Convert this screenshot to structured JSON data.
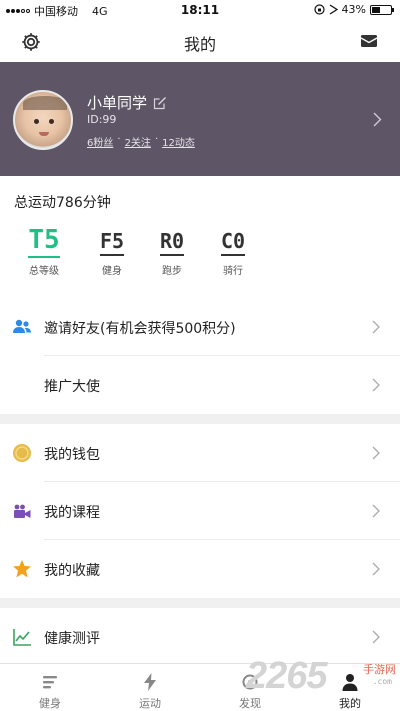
{
  "status_bar": {
    "carrier": "中国移动",
    "network": "4G",
    "time": "18:11",
    "battery": "43%",
    "battery_level": 0.43
  },
  "nav": {
    "title": "我的",
    "left_icon": "gear-icon",
    "right_icon": "mail-icon"
  },
  "profile": {
    "name": "小单同学",
    "id": "ID:99",
    "fans": "6粉丝",
    "following": "2关注",
    "posts": "12动态",
    "dot": "·",
    "bg_color": "#5e5566"
  },
  "total": {
    "label": "总运动786分钟"
  },
  "levels": [
    {
      "code": "T5",
      "label": "总等级"
    },
    {
      "code": "F5",
      "label": "健身"
    },
    {
      "code": "R0",
      "label": "跑步"
    },
    {
      "code": "C0",
      "label": "骑行"
    }
  ],
  "rows": [
    {
      "label": "邀请好友(有机会获得500积分)",
      "icon": "friends-icon"
    },
    {
      "label": "推广大使",
      "icon": ""
    },
    {
      "label": "我的钱包",
      "icon": "coin-icon"
    },
    {
      "label": "我的课程",
      "icon": "video-camera-icon"
    },
    {
      "label": "我的收藏",
      "icon": "star-icon"
    },
    {
      "label": "健康测评",
      "icon": "chart-line-icon"
    }
  ],
  "tabs": [
    {
      "label": "健身",
      "icon": "list-icon"
    },
    {
      "label": "运动",
      "icon": "lightning-icon"
    },
    {
      "label": "发现",
      "icon": "discover-icon"
    },
    {
      "label": "我的",
      "icon": "person-icon",
      "active": true
    }
  ],
  "watermark": {
    "brand": "2265",
    "tag": "手游网",
    "url": ".com"
  },
  "colors": {
    "accent_green": "#1fbf86",
    "header_bg": "#5e5566",
    "icon_blue": "#2f8ae6",
    "icon_gold": "#e6bb4a",
    "icon_purple": "#7b4fb3",
    "icon_orange": "#f2a21f",
    "icon_green": "#3aa360"
  }
}
